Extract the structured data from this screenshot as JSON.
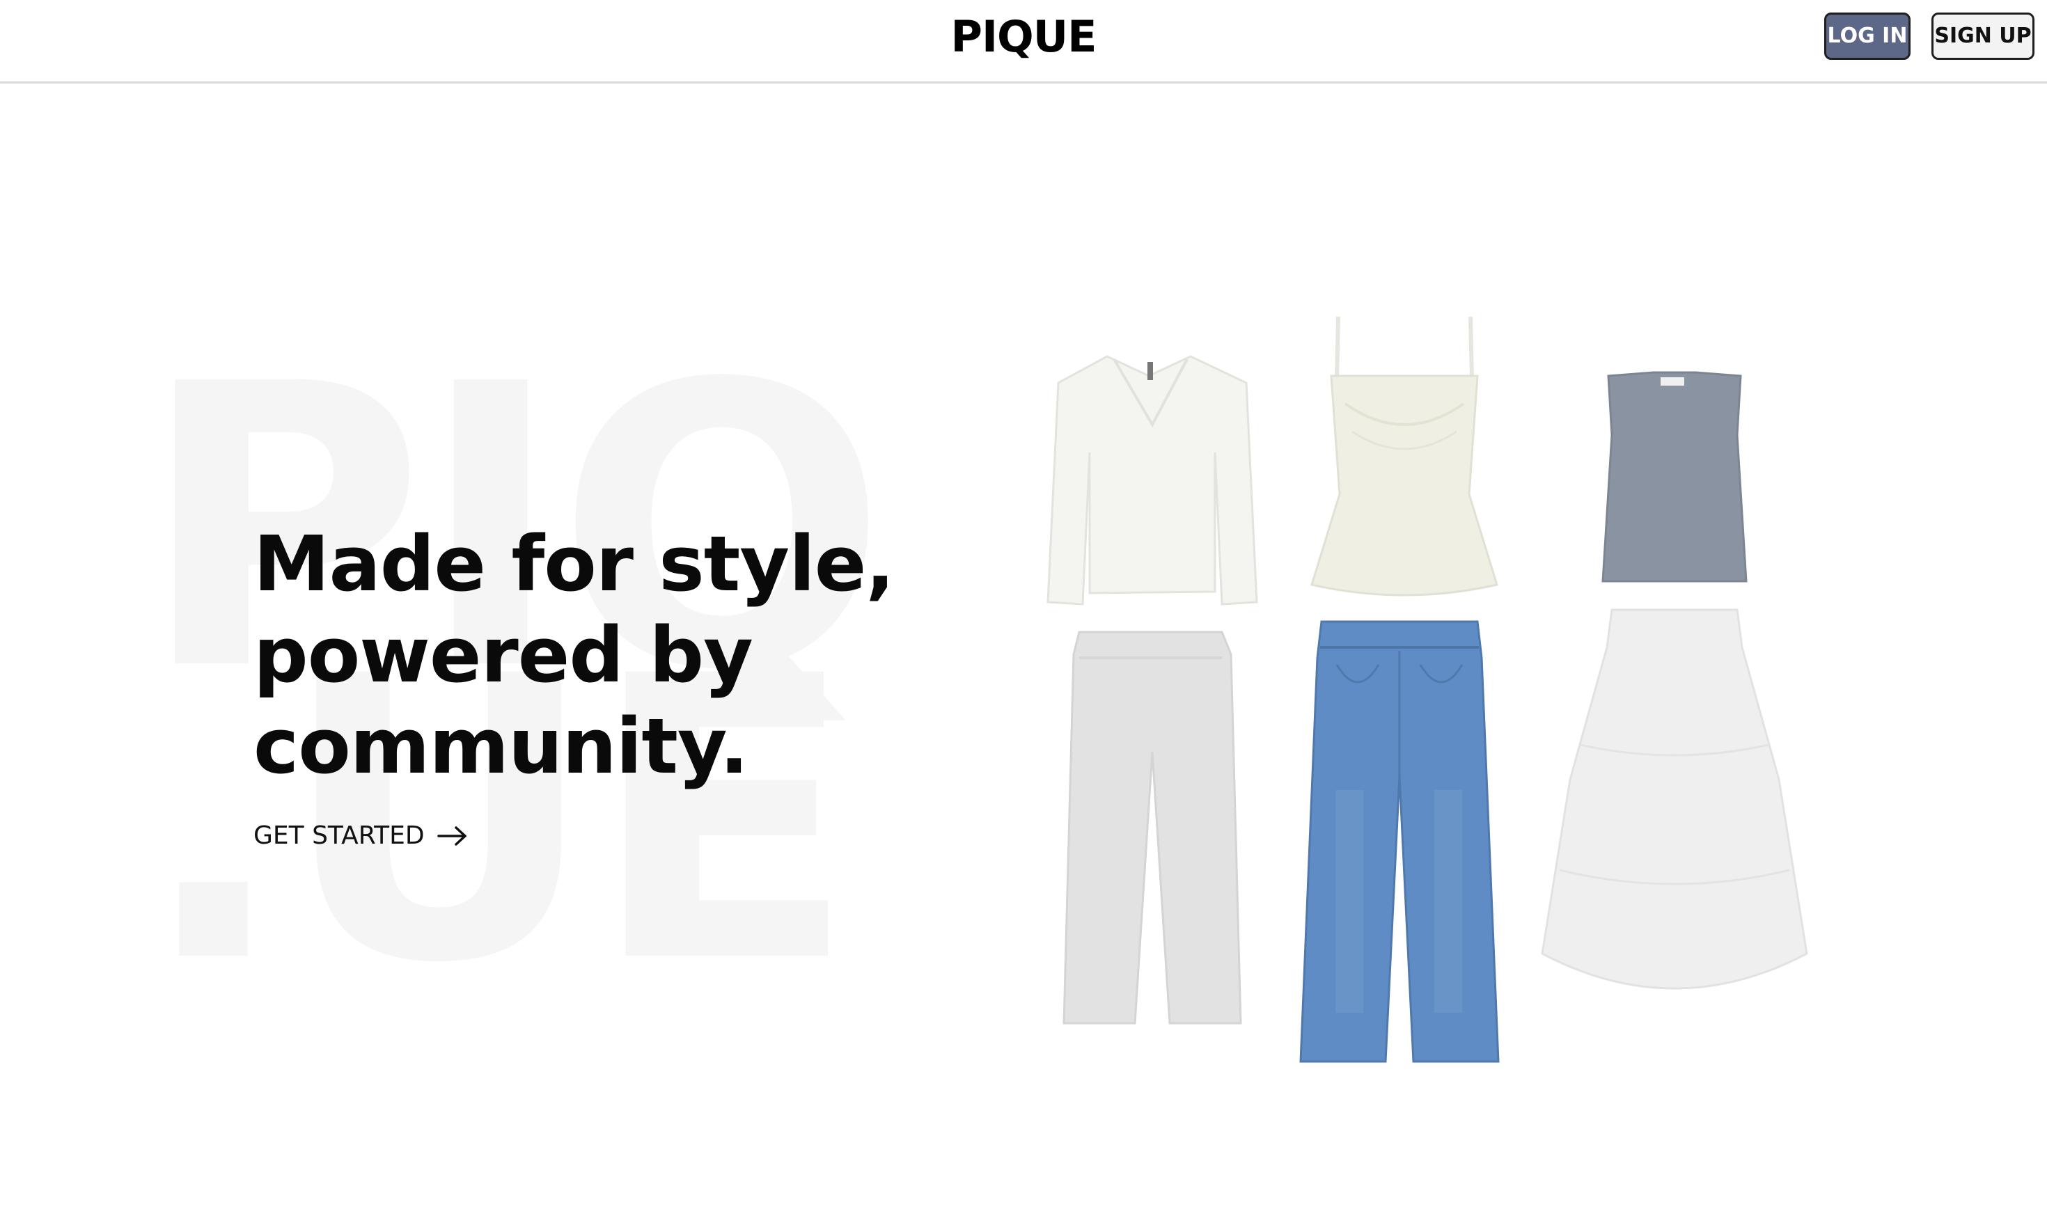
{
  "header": {
    "logo": "PIQUE",
    "login_label": "LOG IN",
    "signup_label": "SIGN UP"
  },
  "hero": {
    "watermark_top": "PIQ",
    "watermark_bottom": ".UE",
    "headline_lines": [
      "Made for style,",
      "powered by",
      "community."
    ],
    "cta_label": "GET STARTED",
    "cta_icon": "arrow-right-icon"
  },
  "garments": [
    {
      "name": "white-vneck-sweater",
      "color": "#f4f4f1"
    },
    {
      "name": "cream-satin-camisole",
      "color": "#efefe3"
    },
    {
      "name": "slate-sleeveless-top",
      "color": "#8a93a1"
    },
    {
      "name": "grey-sweatpants",
      "color": "#e2e2e2"
    },
    {
      "name": "blue-wide-leg-jeans",
      "color": "#5f8cc4"
    },
    {
      "name": "white-tiered-maxi-skirt",
      "color": "#efefef"
    }
  ],
  "colors": {
    "accent": "#5d6787",
    "text": "#0a0a0a",
    "watermark": "#f5f5f5",
    "divider": "#d9d9d9"
  }
}
